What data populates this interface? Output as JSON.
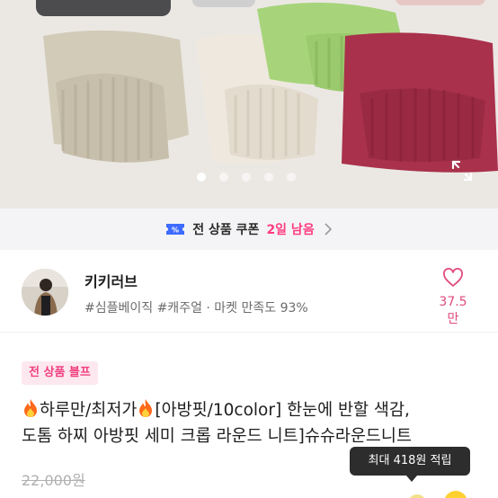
{
  "hero": {
    "slide_count": 5,
    "active_slide": 1,
    "colors": {
      "background": "#e9e6e2",
      "beige_knit": "#cfc7b4",
      "cream_knit": "#ece4da",
      "green_knit": "#a9d57a",
      "burgundy_knit": "#a8304a",
      "charcoal_knit": "#4a4a4c"
    }
  },
  "coupon": {
    "label": "전 상품 쿠폰",
    "remaining": "2일 남음",
    "icon": "coupon-ticket-icon"
  },
  "shop": {
    "name": "키키러브",
    "tags": "#심플베이직 #캐주얼 · 마켓 만족도 93%",
    "likes": "37.5만"
  },
  "product": {
    "badge": "전 상품 블프",
    "title_line1": "하루만/최저가",
    "title_line1b": "[아방핏/10color] 한눈에 반할 색감,",
    "title_line2": "도톰 하찌 아방핏 세미 크롭 라운드 니트]슈슈라운드니트",
    "original_price": "22,000원",
    "points_tooltip": "최대 418원 적립"
  },
  "colors": {
    "accent_pink": "#ff3d7f",
    "badge_bg": "#fde8f0",
    "tooltip_bg": "#2d2d2d"
  }
}
